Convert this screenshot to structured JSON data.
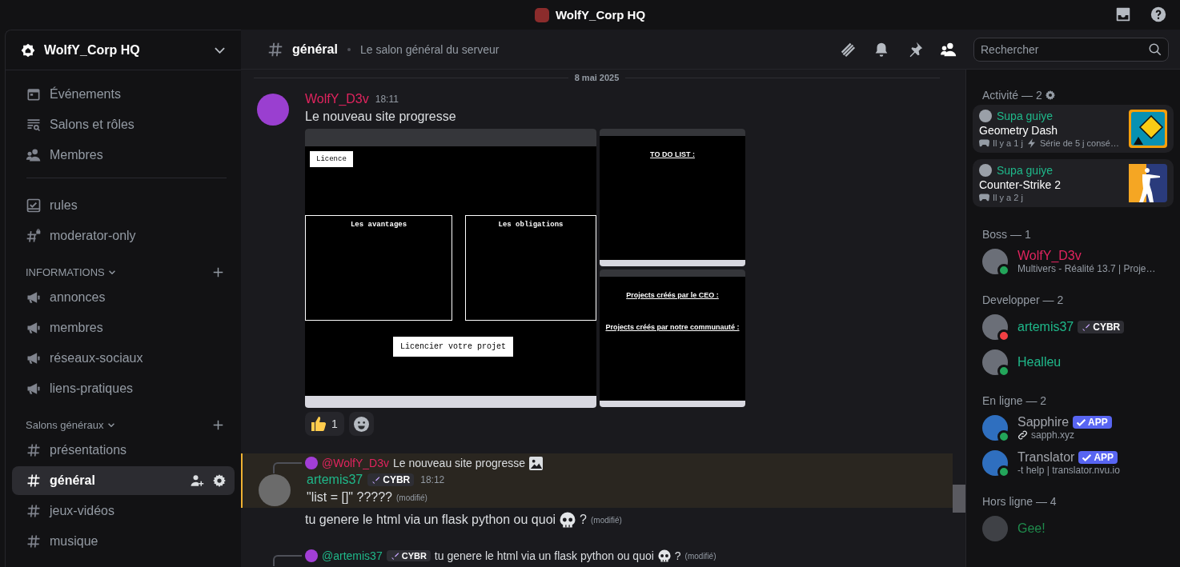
{
  "window": {
    "title": "WolfY_Corp HQ"
  },
  "sidebar": {
    "server_name": "WolfY_Corp HQ",
    "nav": [
      {
        "label": "Événements",
        "kind": "events"
      },
      {
        "label": "Salons et rôles",
        "kind": "browse"
      },
      {
        "label": "Membres",
        "kind": "members"
      }
    ],
    "channels": [
      {
        "name": "rules",
        "kind": "rules",
        "selected": false
      },
      {
        "name": "moderator-only",
        "kind": "locked",
        "selected": false
      }
    ],
    "categories": [
      {
        "name": "INFORMATIONS",
        "channels": [
          {
            "name": "annonces",
            "kind": "announcement",
            "selected": false
          },
          {
            "name": "membres",
            "kind": "announcement",
            "selected": false
          },
          {
            "name": "réseaux-sociaux",
            "kind": "announcement",
            "selected": false
          },
          {
            "name": "liens-pratiques",
            "kind": "announcement",
            "selected": false
          }
        ]
      },
      {
        "name": "Salons généraux",
        "channels": [
          {
            "name": "présentations",
            "kind": "text",
            "selected": false
          },
          {
            "name": "général",
            "kind": "text",
            "selected": true
          },
          {
            "name": "jeux-vidéos",
            "kind": "text",
            "selected": false
          },
          {
            "name": "musique",
            "kind": "text",
            "selected": false
          }
        ]
      }
    ]
  },
  "chat": {
    "channel": "général",
    "topic": "Le salon général du serveur",
    "search": {
      "placeholder": "Rechercher"
    },
    "date_divider": "8 mai 2025",
    "messages": [
      {
        "kind": "post",
        "author": "WolfY_D3v",
        "color": "#e0245e",
        "time": "18:11",
        "text": "Le nouveau site progresse",
        "attachments": [
          {
            "kind": "licence",
            "button": "Licence",
            "boxes": [
              "Les avantages",
              "Les obligations"
            ],
            "cta": "Licencier votre projet"
          },
          {
            "kind": "todo",
            "title": "TO DO LIST :"
          },
          {
            "kind": "projects",
            "title": "Projects créés par le CEO :",
            "subtitle": "Projects créés par notre communauté :"
          }
        ],
        "reactions": [
          {
            "count": "1"
          }
        ]
      },
      {
        "kind": "reply",
        "mentioned": true,
        "reply": {
          "author": "@WolfY_D3v",
          "color": "#e0245e",
          "text": "Le nouveau site progresse",
          "has_image": true
        },
        "author": "artemis37",
        "color": "#1fb88a",
        "tag": "CYBR",
        "time": "18:12",
        "text": "\"list = []\" ?????",
        "edited": "(modifié)"
      },
      {
        "kind": "continuation",
        "text": "tu genere le html via un flask python ou quoi",
        "suffix": "?",
        "edited": "(modifié)"
      },
      {
        "kind": "reply",
        "mentioned": false,
        "reply": {
          "author": "@artemis37",
          "color": "#1fb88a",
          "tag": "CYBR",
          "text": "tu genere le html via un flask python ou quoi",
          "suffix": "?",
          "edited": "(modifié)"
        }
      }
    ]
  },
  "members": {
    "activity": {
      "title": "Activité — 2",
      "cards": [
        {
          "user": "Supa guiye",
          "game": "Geometry Dash",
          "time": "Il y a 1 j",
          "streak": "Série de 5 j consé…"
        },
        {
          "user": "Supa guiye",
          "game": "Counter-Strike 2",
          "time": "Il y a 2 j"
        }
      ]
    },
    "groups": [
      {
        "title": "Boss — 1",
        "members": [
          {
            "kind": "user",
            "name": "WolfY_D3v",
            "color": "#e0245e",
            "status_dot": {
              "color": "#23a55a"
            },
            "subtitle": "Multivers - Réalité 13.7 | Proje…"
          }
        ]
      },
      {
        "title": "Developper — 2",
        "members": [
          {
            "kind": "user",
            "name": "artemis37",
            "color": "#1fb88a",
            "status_dot": {
              "color": "#f23f43"
            },
            "tag": "CYBR"
          },
          {
            "kind": "user",
            "name": "Healleu",
            "color": "#1fb88a",
            "status_dot": {
              "color": "#23a55a"
            }
          }
        ]
      },
      {
        "title": "En ligne — 2",
        "members": [
          {
            "kind": "linkapp",
            "name": "Sapphire",
            "color": "#a3a6ad",
            "status_dot": {
              "color": "#23a55a"
            },
            "app": "APP",
            "subtitle": "sapph.xyz"
          },
          {
            "kind": "app",
            "name": "Translator",
            "color": "#a3a6ad",
            "status_dot": {
              "color": "#23a55a"
            },
            "app": "APP",
            "subtitle": "-t help | translator.nvu.io"
          }
        ]
      },
      {
        "title": "Hors ligne — 4",
        "members": [
          {
            "kind": "user",
            "name": "Gee!",
            "color": "#1f8b4c"
          }
        ]
      }
    ]
  }
}
